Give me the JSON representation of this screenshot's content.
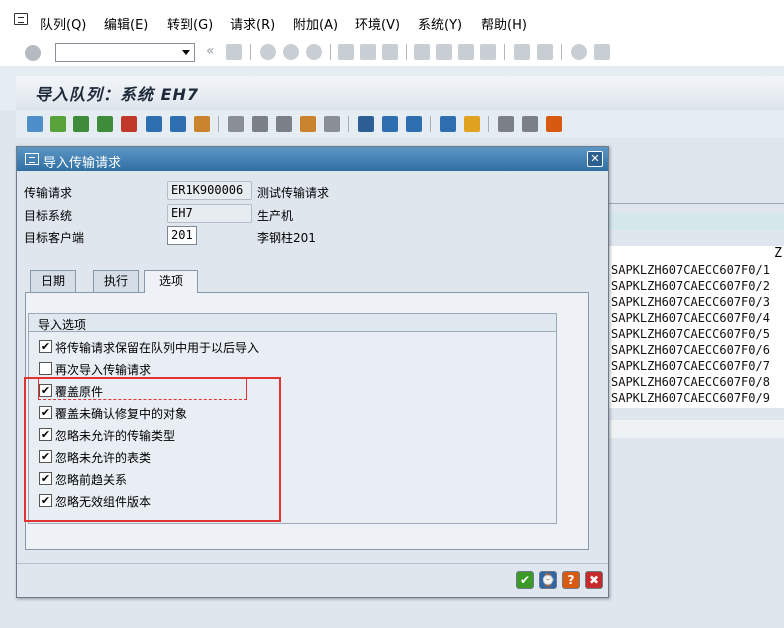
{
  "menu": {
    "items": [
      {
        "label": "队列(Q)"
      },
      {
        "label": "编辑(E)"
      },
      {
        "label": "转到(G)"
      },
      {
        "label": "请求(R)"
      },
      {
        "label": "附加(A)"
      },
      {
        "label": "环境(V)"
      },
      {
        "label": "系统(Y)"
      },
      {
        "label": "帮助(H)"
      }
    ]
  },
  "command_field": {
    "value": ""
  },
  "page": {
    "title": "导入队列：系统 EH7"
  },
  "background_list": {
    "column_header": "Z",
    "rows": [
      "SAPKLZH607CAECC607F0/1",
      "SAPKLZH607CAECC607F0/2",
      "SAPKLZH607CAECC607F0/3",
      "SAPKLZH607CAECC607F0/4",
      "SAPKLZH607CAECC607F0/5",
      "SAPKLZH607CAECC607F0/6",
      "SAPKLZH607CAECC607F0/7",
      "SAPKLZH607CAECC607F0/8",
      "SAPKLZH607CAECC607F0/9"
    ]
  },
  "dialog": {
    "title": "导入传输请求",
    "fields": [
      {
        "label": "传输请求",
        "value": "ER1K900006",
        "desc": "测试传输请求"
      },
      {
        "label": "目标系统",
        "value": "EH7",
        "desc": "生产机"
      },
      {
        "label": "目标客户端",
        "value": "201",
        "desc": "李钢柱201"
      }
    ],
    "tabs": [
      {
        "label": "日期"
      },
      {
        "label": "执行"
      },
      {
        "label": "选项"
      }
    ],
    "active_tab": "选项",
    "group_title": "导入选项",
    "options": [
      {
        "label": "将传输请求保留在队列中用于以后导入",
        "checked": true
      },
      {
        "label": "再次导入传输请求",
        "checked": false
      },
      {
        "label": "覆盖原件",
        "checked": true
      },
      {
        "label": "覆盖未确认修复中的对象",
        "checked": true
      },
      {
        "label": "忽略未允许的传输类型",
        "checked": true
      },
      {
        "label": "忽略未允许的表类",
        "checked": true
      },
      {
        "label": "忽略前趋关系",
        "checked": true
      },
      {
        "label": "忽略无效组件版本",
        "checked": true
      }
    ],
    "check_mark": "✔",
    "footer_buttons": [
      {
        "icon": "confirm-icon",
        "glyph": "✔",
        "color": "#3c9a2b"
      },
      {
        "icon": "schedule-icon",
        "glyph": "⌚",
        "color": "#2c66a8"
      },
      {
        "icon": "help-icon",
        "glyph": "?",
        "color": "#d85a10"
      },
      {
        "icon": "cancel-icon",
        "glyph": "✖",
        "color": "#c62a2a"
      }
    ],
    "close_glyph": "✕"
  },
  "colors": {
    "title_bar": "#2f6fa5",
    "highlight_frame": "#e23333"
  }
}
